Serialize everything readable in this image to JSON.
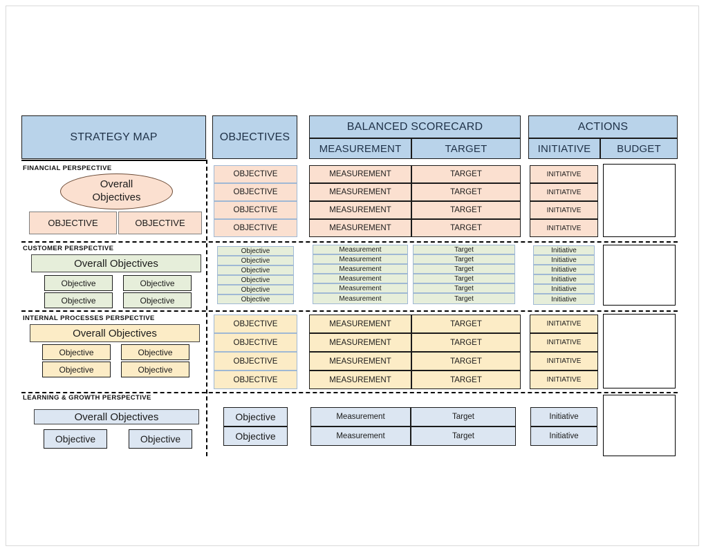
{
  "headers": {
    "strategy_map": "STRATEGY MAP",
    "objectives": "OBJECTIVES",
    "balanced_scorecard": "BALANCED SCORECARD",
    "actions": "ACTIONS",
    "measurement": "MEASUREMENT",
    "target": "TARGET",
    "initiative": "INITIATIVE",
    "budget": "BUDGET"
  },
  "colors": {
    "header_fill": "#b9d3ea",
    "financial_fill": "#fbe0d0",
    "customer_fill": "#e6eeda",
    "internal_fill": "#fcecc6",
    "learning_fill": "#dce6f2",
    "border": "#1a1a1a"
  },
  "perspectives": [
    {
      "id": "financial",
      "label": "FINANCIAL PERSPECTIVE",
      "overall": "Overall\nObjectives",
      "overall_line1": "Overall",
      "overall_line2": "Objectives",
      "map_boxes": [
        "OBJECTIVE",
        "OBJECTIVE"
      ],
      "objectives": [
        "OBJECTIVE",
        "OBJECTIVE",
        "OBJECTIVE",
        "OBJECTIVE"
      ],
      "measurements": [
        "MEASUREMENT",
        "MEASUREMENT",
        "MEASUREMENT",
        "MEASUREMENT"
      ],
      "targets": [
        "TARGET",
        "TARGET",
        "TARGET",
        "TARGET"
      ],
      "initiatives": [
        "INITIATIVE",
        "INITIATIVE",
        "INITIATIVE",
        "INITIATIVE"
      ],
      "budget": ""
    },
    {
      "id": "customer",
      "label": "CUSTOMER  PERSPECTIVE",
      "overall": "Overall Objectives",
      "map_boxes": [
        "Objective",
        "Objective",
        "Objective",
        "Objective"
      ],
      "objectives": [
        "Objective",
        "Objective",
        "Objective",
        "Objective",
        "Objective",
        "Objective"
      ],
      "measurements": [
        "Measurement",
        "Measurement",
        "Measurement",
        "Measurement",
        "Measurement",
        "Measurement"
      ],
      "targets": [
        "Target",
        "Target",
        "Target",
        "Target",
        "Target",
        "Target"
      ],
      "initiatives": [
        "Initiative",
        "Initiative",
        "Initiative",
        "Initiative",
        "Initiative",
        "Initiative"
      ],
      "budget": ""
    },
    {
      "id": "internal",
      "label": "INTERNAL  PROCESSES  PERSPECTIVE",
      "overall": "Overall Objectives",
      "map_boxes": [
        "Objective",
        "Objective",
        "Objective",
        "Objective"
      ],
      "objectives": [
        "OBJECTIVE",
        "OBJECTIVE",
        "OBJECTIVE",
        "OBJECTIVE"
      ],
      "measurements": [
        "MEASUREMENT",
        "MEASUREMENT",
        "MEASUREMENT",
        "MEASUREMENT"
      ],
      "targets": [
        "TARGET",
        "TARGET",
        "TARGET",
        "TARGET"
      ],
      "initiatives": [
        "INITIATIVE",
        "INITIATIVE",
        "INITIATIVE",
        "INITIATIVE"
      ],
      "budget": ""
    },
    {
      "id": "learning",
      "label": "LEARNING & GROWTH  PERSPECTIVE",
      "overall": "Overall Objectives",
      "map_boxes": [
        "Objective",
        "Objective"
      ],
      "objectives": [
        "Objective",
        "Objective"
      ],
      "measurements": [
        "Measurement",
        "Measurement"
      ],
      "targets": [
        "Target",
        "Target"
      ],
      "initiatives": [
        "Initiative",
        "Initiative"
      ],
      "budget": ""
    }
  ]
}
